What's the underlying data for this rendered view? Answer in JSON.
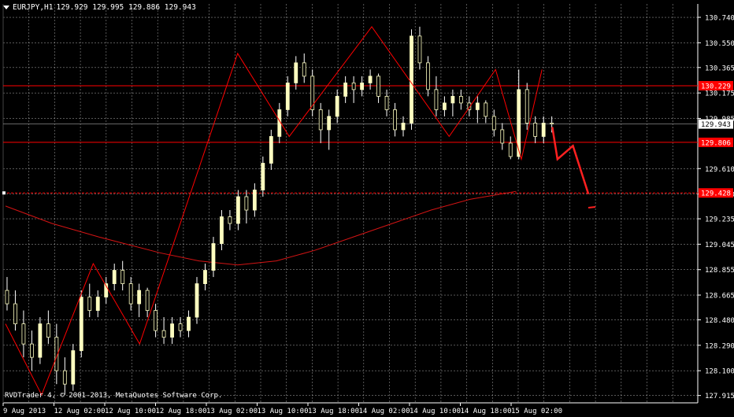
{
  "header": {
    "symbol": "EURJPY,H1",
    "ohlc": "129.929 129.995 129.886 129.943"
  },
  "footer": {
    "copyright": "RVDTrader 4, © 2001-2013, MetaQuotes Software Corp."
  },
  "colors": {
    "background": "#000000",
    "grid": "#C8C8C8",
    "axis": "#FFFFFF",
    "candle_body": "#FFFFC0",
    "candle_wick": "#FFFFFF",
    "level": "#FF0000",
    "ma": "#D41414",
    "zigzag": "#FF0000",
    "forecast": "#FF2020"
  },
  "chart_data": {
    "type": "candlestick",
    "instrument": "EURJPY",
    "timeframe": "H1",
    "ylim": [
      127.86,
      130.84
    ],
    "y_ticks": [
      "130.740",
      "130.550",
      "130.365",
      "130.175",
      "129.985",
      "129.610",
      "129.420",
      "129.235",
      "129.045",
      "128.855",
      "128.665",
      "128.480",
      "128.290",
      "128.100",
      "127.915"
    ],
    "x_ticks": [
      "9 Aug 2013",
      "12 Aug 02:00",
      "12 Aug 10:00",
      "12 Aug 18:00",
      "13 Aug 02:00",
      "13 Aug 10:00",
      "13 Aug 18:00",
      "14 Aug 02:00",
      "14 Aug 10:00",
      "14 Aug 18:00",
      "15 Aug 02:00"
    ],
    "current_price": "129.943",
    "levels": [
      {
        "price": 130.229,
        "label": "130.229"
      },
      {
        "price": 129.806,
        "label": "129.806"
      },
      {
        "price": 129.428,
        "label": "129.428",
        "dashed": true
      }
    ],
    "candles": [
      [
        128.7,
        128.8,
        128.55,
        128.6
      ],
      [
        128.6,
        128.7,
        128.4,
        128.45
      ],
      [
        128.45,
        128.55,
        128.2,
        128.3
      ],
      [
        128.3,
        128.4,
        128.1,
        128.2
      ],
      [
        128.2,
        128.5,
        128.15,
        128.45
      ],
      [
        128.45,
        128.55,
        128.3,
        128.35
      ],
      [
        128.35,
        128.45,
        128.0,
        128.1
      ],
      [
        128.1,
        128.2,
        127.92,
        128.0
      ],
      [
        128.0,
        128.3,
        127.95,
        128.25
      ],
      [
        128.25,
        128.7,
        128.2,
        128.65
      ],
      [
        128.65,
        128.75,
        128.5,
        128.55
      ],
      [
        128.55,
        128.7,
        128.5,
        128.65
      ],
      [
        128.65,
        128.8,
        128.6,
        128.75
      ],
      [
        128.75,
        128.9,
        128.7,
        128.85
      ],
      [
        128.85,
        128.92,
        128.7,
        128.75
      ],
      [
        128.75,
        128.8,
        128.55,
        128.6
      ],
      [
        128.6,
        128.75,
        128.5,
        128.7
      ],
      [
        128.7,
        128.72,
        128.5,
        128.55
      ],
      [
        128.55,
        128.6,
        128.35,
        128.4
      ],
      [
        128.4,
        128.5,
        128.3,
        128.35
      ],
      [
        128.35,
        128.5,
        128.3,
        128.45
      ],
      [
        128.45,
        128.5,
        128.35,
        128.4
      ],
      [
        128.4,
        128.55,
        128.35,
        128.5
      ],
      [
        128.5,
        128.8,
        128.45,
        128.75
      ],
      [
        128.75,
        128.9,
        128.7,
        128.85
      ],
      [
        128.85,
        129.1,
        128.8,
        129.05
      ],
      [
        129.05,
        129.3,
        129.0,
        129.25
      ],
      [
        129.25,
        129.3,
        129.15,
        129.2
      ],
      [
        129.2,
        129.45,
        129.15,
        129.4
      ],
      [
        129.4,
        129.45,
        129.2,
        129.3
      ],
      [
        129.3,
        129.5,
        129.25,
        129.45
      ],
      [
        129.45,
        129.7,
        129.4,
        129.65
      ],
      [
        129.65,
        129.9,
        129.6,
        129.85
      ],
      [
        129.85,
        130.1,
        129.8,
        130.05
      ],
      [
        130.05,
        130.3,
        130.0,
        130.25
      ],
      [
        130.25,
        130.45,
        130.2,
        130.4
      ],
      [
        130.4,
        130.47,
        130.25,
        130.3
      ],
      [
        130.3,
        130.35,
        130.0,
        130.05
      ],
      [
        130.05,
        130.1,
        129.8,
        129.9
      ],
      [
        129.9,
        130.05,
        129.75,
        130.0
      ],
      [
        130.0,
        130.2,
        129.95,
        130.15
      ],
      [
        130.15,
        130.3,
        130.1,
        130.25
      ],
      [
        130.25,
        130.3,
        130.1,
        130.2
      ],
      [
        130.2,
        130.3,
        130.15,
        130.25
      ],
      [
        130.25,
        130.35,
        130.2,
        130.3
      ],
      [
        130.3,
        130.32,
        130.1,
        130.15
      ],
      [
        130.15,
        130.2,
        130.0,
        130.05
      ],
      [
        130.05,
        130.1,
        129.85,
        129.9
      ],
      [
        129.9,
        130.0,
        129.85,
        129.95
      ],
      [
        129.95,
        130.65,
        129.9,
        130.6
      ],
      [
        130.6,
        130.67,
        130.35,
        130.4
      ],
      [
        130.4,
        130.45,
        130.15,
        130.2
      ],
      [
        130.2,
        130.3,
        130.0,
        130.05
      ],
      [
        130.05,
        130.15,
        130.0,
        130.1
      ],
      [
        130.1,
        130.2,
        130.0,
        130.15
      ],
      [
        130.15,
        130.2,
        130.05,
        130.1
      ],
      [
        130.1,
        130.15,
        130.0,
        130.05
      ],
      [
        130.05,
        130.15,
        129.95,
        130.1
      ],
      [
        130.1,
        130.12,
        129.95,
        130.0
      ],
      [
        130.0,
        130.05,
        129.85,
        129.9
      ],
      [
        129.9,
        129.95,
        129.75,
        129.8
      ],
      [
        129.8,
        129.85,
        129.68,
        129.7
      ],
      [
        129.7,
        130.35,
        129.68,
        130.2
      ],
      [
        130.2,
        130.25,
        129.9,
        129.95
      ],
      [
        129.95,
        130.0,
        129.8,
        129.85
      ],
      [
        129.85,
        130.0,
        129.8,
        129.95
      ],
      [
        129.95,
        130.0,
        129.88,
        129.943
      ]
    ],
    "moving_average": [
      [
        0,
        129.33
      ],
      [
        6,
        129.2
      ],
      [
        12,
        129.1
      ],
      [
        20,
        128.98
      ],
      [
        25,
        128.92
      ],
      [
        30,
        128.89
      ],
      [
        35,
        128.92
      ],
      [
        40,
        129.0
      ],
      [
        45,
        129.1
      ],
      [
        50,
        129.2
      ],
      [
        55,
        129.3
      ],
      [
        60,
        129.38
      ],
      [
        64,
        129.42
      ],
      [
        66,
        129.44
      ]
    ],
    "zigzag": [
      [
        0,
        128.45
      ],
      [
        7,
        127.92
      ],
      [
        17,
        128.9
      ],
      [
        26,
        128.3
      ],
      [
        45,
        130.47
      ],
      [
        55,
        129.85
      ],
      [
        71,
        130.67
      ],
      [
        86,
        129.85
      ],
      [
        95,
        130.35
      ],
      [
        100,
        129.68
      ],
      [
        104,
        130.35
      ]
    ],
    "forecast": [
      [
        106,
        129.92
      ],
      [
        107,
        129.68
      ],
      [
        110,
        129.78
      ],
      [
        113,
        129.42
      ]
    ]
  }
}
